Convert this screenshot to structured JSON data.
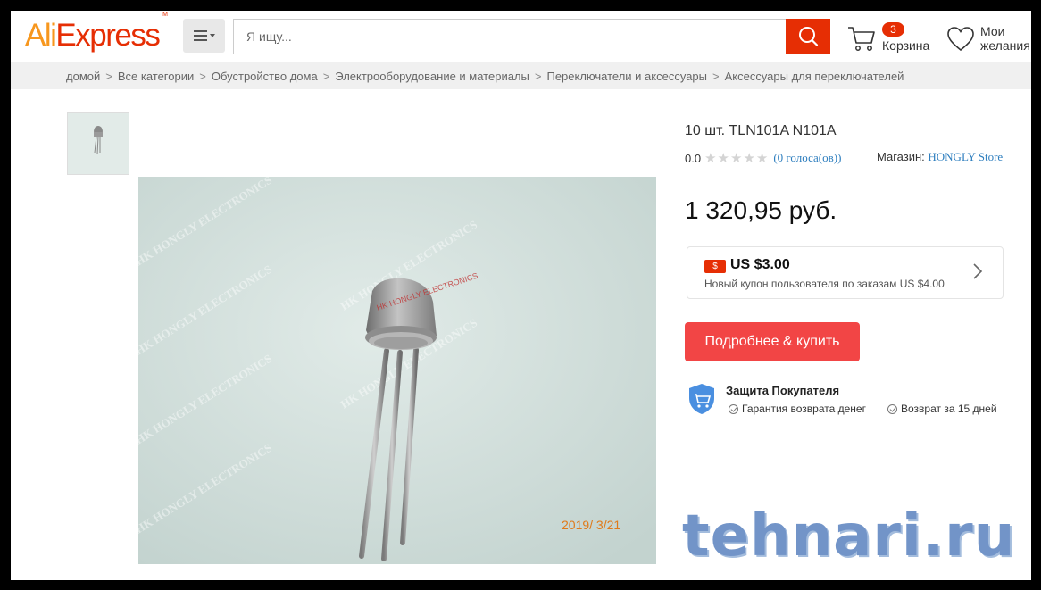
{
  "header": {
    "logo_part1": "Ali",
    "logo_part2": "Express",
    "logo_tm": "TM",
    "search_placeholder": "Я ищу...",
    "cart_count": "3",
    "cart_label": "Корзина",
    "wishlist_line1": "Мои",
    "wishlist_line2": "желания"
  },
  "breadcrumb": [
    "домой",
    "Все категории",
    "Обустройство дома",
    "Электрооборудование и материалы",
    "Переключатели и аксессуары",
    "Аксессуары для переключателей"
  ],
  "breadcrumb_separator": ">",
  "product": {
    "title": "10 шт. TLN101A N101A",
    "rating": "0.0",
    "stars_filled": 0,
    "stars_total": 5,
    "votes": "(0 голоса(ов))",
    "store_label": "Магазин:",
    "store_name": "HONGLY Store",
    "price": "1 320,95 руб.",
    "image_date_stamp": "2019/ 3/21",
    "image_watermark": "HK HONGLY ELECTRONICS"
  },
  "coupon": {
    "icon_symbol": "$",
    "amount": "US $3.00",
    "description": "Новый купон пользователя по заказам US $4.00"
  },
  "buy_button": "Подробнее & купить",
  "protection": {
    "title": "Защита Покупателя",
    "items": [
      "Гарантия возврата денег",
      "Возврат за 15 дней"
    ]
  },
  "watermark": "tehnari.ru",
  "colors": {
    "brand_red": "#e62e04",
    "logo_orange": "#f7971e",
    "buy_button": "#f24545",
    "link_blue": "#2f7fbf"
  }
}
